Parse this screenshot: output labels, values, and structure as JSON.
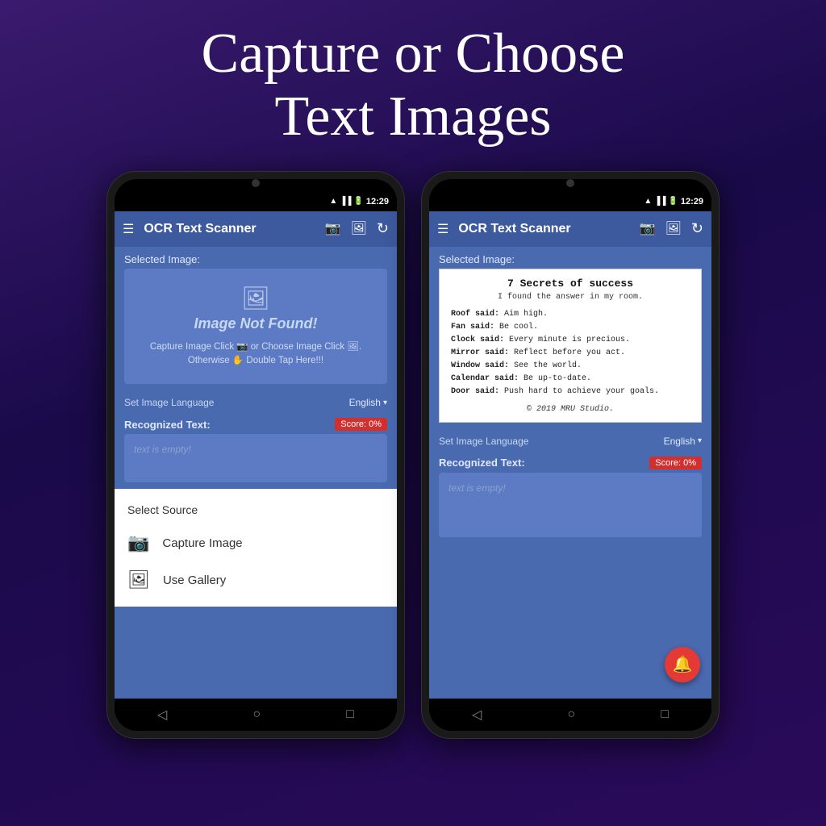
{
  "headline": {
    "line1": "Capture or Choose",
    "line2": "Text Images"
  },
  "phone_left": {
    "status_bar": {
      "time": "12:29"
    },
    "app_bar": {
      "title": "OCR Text Scanner",
      "icons": [
        "📷",
        "🖼",
        "↻"
      ]
    },
    "selected_image_label": "Selected Image:",
    "image_not_found_text": "Image Not Found!",
    "image_hint": "Capture Image Click 📷 or Choose Image Click 🖼. Otherwise ✋ Double Tap Here!!!",
    "language_label": "Set Image Language",
    "language_value": "English",
    "recognized_text_label": "Recognized Text:",
    "score_badge": "Score: 0%",
    "text_placeholder": "text is empty!",
    "bottom_sheet": {
      "title": "Select Source",
      "items": [
        {
          "icon": "camera",
          "label": "Capture Image"
        },
        {
          "icon": "gallery",
          "label": "Use Gallery"
        }
      ]
    },
    "nav": [
      "◁",
      "○",
      "□"
    ]
  },
  "phone_right": {
    "status_bar": {
      "time": "12:29"
    },
    "app_bar": {
      "title": "OCR Text Scanner",
      "icons": [
        "📷",
        "🖼",
        "↻"
      ]
    },
    "selected_image_label": "Selected Image:",
    "ocr_content": {
      "title": "7  Secrets  of  success",
      "subtitle": "I found the answer in my room.",
      "quotes": [
        {
          "key": "Roof said:",
          "value": " Aim high."
        },
        {
          "key": "Fan said:",
          "value": " Be cool."
        },
        {
          "key": "Clock said:",
          "value": " Every minute is precious."
        },
        {
          "key": "Mirror said:",
          "value": " Reflect before you act."
        },
        {
          "key": "Window said:",
          "value": " See the world."
        },
        {
          "key": "Calendar said:",
          "value": " Be up-to-date."
        },
        {
          "key": "Door said:",
          "value": " Push hard to achieve your goals."
        }
      ],
      "copyright": "© 2019 MRU Studio."
    },
    "language_label": "Set Image Language",
    "language_value": "English",
    "recognized_text_label": "Recognized Text:",
    "score_badge": "Score: 0%",
    "text_placeholder": "text is empty!",
    "nav": [
      "◁",
      "○",
      "□"
    ],
    "fab_icon": "🔔"
  }
}
